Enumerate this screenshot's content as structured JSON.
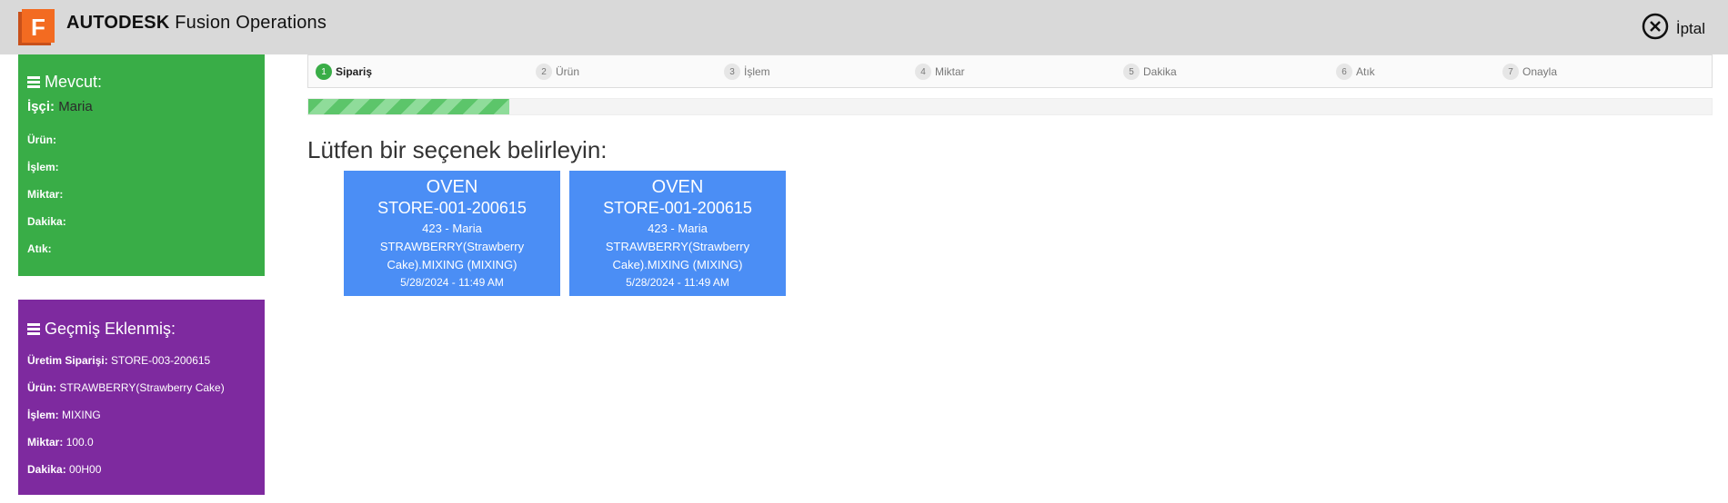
{
  "header": {
    "logo_letter": "F",
    "brand_bold": "AUTODESK",
    "brand_rest": "Fusion Operations",
    "cancel_label": "İptal"
  },
  "current": {
    "title": "Mevcut:",
    "worker_label": "İşçi:",
    "worker_value": "Maria",
    "fields": [
      "Ürün:",
      "İşlem:",
      "Miktar:",
      "Dakika:",
      "Atık:"
    ]
  },
  "history": {
    "title": "Geçmiş Eklenmiş:",
    "rows": [
      {
        "label": "Üretim Siparişi:",
        "value": "STORE-003-200615"
      },
      {
        "label": "Ürün:",
        "value": "STRAWBERRY(Strawberry Cake)"
      },
      {
        "label": "İşlem:",
        "value": "MIXING"
      },
      {
        "label": "Miktar:",
        "value": "100.0"
      },
      {
        "label": "Dakika:",
        "value": "00H00"
      }
    ]
  },
  "steps": [
    {
      "num": "1",
      "label": "Sipariş"
    },
    {
      "num": "2",
      "label": "Ürün"
    },
    {
      "num": "3",
      "label": "İşlem"
    },
    {
      "num": "4",
      "label": "Miktar"
    },
    {
      "num": "5",
      "label": "Dakika"
    },
    {
      "num": "6",
      "label": "Atık"
    },
    {
      "num": "7",
      "label": "Onayla"
    }
  ],
  "progress_fraction": 0.143,
  "prompt": "Lütfen bir seçenek belirleyin:",
  "cards": [
    {
      "title": "OVEN",
      "order": "STORE-001-200615",
      "worker": "423 - Maria",
      "operation": "STRAWBERRY(Strawberry Cake).MIXING (MIXING)",
      "datetime": "5/28/2024 - 11:49 AM"
    },
    {
      "title": "OVEN",
      "order": "STORE-001-200615",
      "worker": "423 - Maria",
      "operation": "STRAWBERRY(Strawberry Cake).MIXING (MIXING)",
      "datetime": "5/28/2024 - 11:49 AM"
    }
  ],
  "colors": {
    "current_panel": "#39ad47",
    "history_panel": "#7e2a9f",
    "card": "#4b8ef5",
    "logo": "#f36b21"
  },
  "icons": [
    "menu-icon",
    "close-circle-icon",
    "autodesk-fusion-logo"
  ]
}
